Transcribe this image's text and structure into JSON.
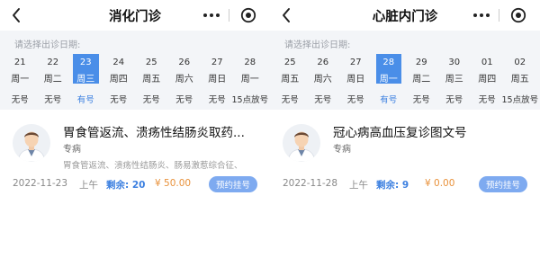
{
  "screens": [
    {
      "title": "消化门诊",
      "date_hint": "请选择出诊日期:",
      "dates": [
        {
          "day": "21",
          "week": "周一",
          "status": "无号",
          "selected": false
        },
        {
          "day": "22",
          "week": "周二",
          "status": "无号",
          "selected": false
        },
        {
          "day": "23",
          "week": "周三",
          "status": "有号",
          "selected": true
        },
        {
          "day": "24",
          "week": "周四",
          "status": "无号",
          "selected": false
        },
        {
          "day": "25",
          "week": "周五",
          "status": "无号",
          "selected": false
        },
        {
          "day": "26",
          "week": "周六",
          "status": "无号",
          "selected": false
        },
        {
          "day": "27",
          "week": "周日",
          "status": "无号",
          "selected": false
        },
        {
          "day": "28",
          "week": "周一",
          "status": "15点放号",
          "selected": false
        }
      ],
      "doctor": {
        "name": "胃食管返流、溃疡性结肠炎取药...",
        "type": "专病",
        "desc": "胃食管返流、溃疡性结肠炎、肠易激惹综合征、",
        "date": "2022-11-23",
        "slot": "上午",
        "remain": "剩余: 20",
        "price": "¥ 50.00",
        "book_label": "预约挂号"
      }
    },
    {
      "title": "心脏内门诊",
      "date_hint": "请选择出诊日期:",
      "dates": [
        {
          "day": "25",
          "week": "周五",
          "status": "无号",
          "selected": false
        },
        {
          "day": "26",
          "week": "周六",
          "status": "无号",
          "selected": false
        },
        {
          "day": "27",
          "week": "周日",
          "status": "无号",
          "selected": false
        },
        {
          "day": "28",
          "week": "周一",
          "status": "有号",
          "selected": true
        },
        {
          "day": "29",
          "week": "周二",
          "status": "无号",
          "selected": false
        },
        {
          "day": "30",
          "week": "周三",
          "status": "无号",
          "selected": false
        },
        {
          "day": "01",
          "week": "周四",
          "status": "无号",
          "selected": false
        },
        {
          "day": "02",
          "week": "周五",
          "status": "15点放号",
          "selected": false
        }
      ],
      "doctor": {
        "name": "冠心病高血压复诊图文号",
        "type": "专病",
        "desc": "",
        "date": "2022-11-28",
        "slot": "上午",
        "remain": "剩余: 9",
        "price": "¥ 0.00",
        "book_label": "预约挂号"
      }
    }
  ],
  "colors": {
    "accent": "#4a8ee8",
    "remain": "#3b7fe0",
    "price": "#e8913a",
    "button": "#7eaaf0",
    "panel": "#f3f5f8"
  },
  "icons": {
    "back": "chevron-left-icon",
    "more": "more-dots-icon",
    "target": "target-icon",
    "avatar": "doctor-avatar"
  }
}
